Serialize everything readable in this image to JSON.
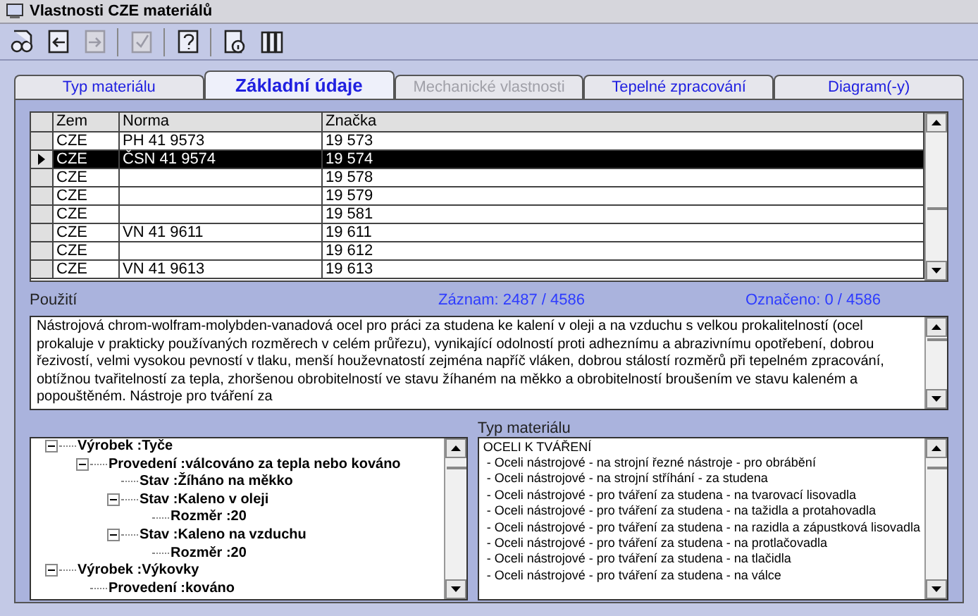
{
  "window": {
    "title": "Vlastnosti CZE materiálů"
  },
  "toolbar": [
    {
      "kind": "people",
      "disabled": false
    },
    {
      "kind": "back",
      "disabled": false
    },
    {
      "kind": "forward",
      "disabled": true
    },
    {
      "kind": "check",
      "disabled": true
    },
    {
      "kind": "help",
      "disabled": false
    },
    {
      "kind": "info",
      "disabled": false
    },
    {
      "kind": "columns",
      "disabled": false
    }
  ],
  "tabs": [
    {
      "label": "Typ materiálu",
      "selected": false,
      "disabled": false
    },
    {
      "label": "Základní údaje",
      "selected": true,
      "disabled": false
    },
    {
      "label": "Mechanické vlastnosti",
      "selected": false,
      "disabled": true
    },
    {
      "label": "Tepelné zpracování",
      "selected": false,
      "disabled": false
    },
    {
      "label": "Diagram(-y)",
      "selected": false,
      "disabled": false
    }
  ],
  "table": {
    "columns": [
      "Zem",
      "Norma",
      "Značka"
    ],
    "rows": [
      {
        "cells": [
          "CZE",
          "PH 41 9573",
          "19 573"
        ],
        "selected": false
      },
      {
        "cells": [
          "CZE",
          "ČSN 41 9574",
          "19 574"
        ],
        "selected": true
      },
      {
        "cells": [
          "CZE",
          "",
          "19 578"
        ],
        "selected": false
      },
      {
        "cells": [
          "CZE",
          "",
          "19 579"
        ],
        "selected": false
      },
      {
        "cells": [
          "CZE",
          "",
          "19 581"
        ],
        "selected": false
      },
      {
        "cells": [
          "CZE",
          "VN 41 9611",
          "19 611"
        ],
        "selected": false
      },
      {
        "cells": [
          "CZE",
          "",
          "19 612"
        ],
        "selected": false
      },
      {
        "cells": [
          "CZE",
          "VN 41 9613",
          "19 613"
        ],
        "selected": false
      }
    ]
  },
  "status": {
    "usage_label": "Použití",
    "record": "Záznam: 2487 / 4586",
    "marked": "Označeno: 0 / 4586"
  },
  "description": "Nástrojová chrom-wolfram-molybden-vanadová ocel pro práci za studena ke kalení v oleji a na vzduchu s velkou prokalitelností (ocel prokaluje v prakticky používaných rozměrech v celém průřezu), vynikající odolností proti adheznímu a abrazivnímu opotřebení, dobrou řezivostí, velmi vysokou pevností v tlaku, menší houževnatostí zejména napříč vláken, dobrou stálostí rozměrů při tepelném zpracování, obtížnou tvařitelností za tepla, zhoršenou obrobitelností ve stavu žíhaném na měkko a obrobitelností broušením ve stavu kaleném a popouštěném. Nástroje pro tváření za",
  "tree": [
    {
      "label": "Výrobek :Tyče",
      "expanded": true,
      "children": [
        {
          "label": "Provedení :válcováno za tepla nebo kováno",
          "expanded": true,
          "children": [
            {
              "label": "Stav :Žíháno na měkko"
            },
            {
              "label": "Stav :Kaleno v oleji",
              "expanded": true,
              "children": [
                {
                  "label": "Rozměr :20"
                }
              ]
            },
            {
              "label": "Stav :Kaleno na vzduchu",
              "expanded": true,
              "children": [
                {
                  "label": "Rozměr :20"
                }
              ]
            }
          ]
        }
      ]
    },
    {
      "label": "Výrobek :Výkovky",
      "expanded": true,
      "children": [
        {
          "label": "Provedení :kováno"
        }
      ]
    }
  ],
  "material_type": {
    "label": "Typ materiálu",
    "items": [
      "OCELI K TVÁŘENÍ",
      " - Oceli nástrojové - na strojní řezné nástroje - pro obrábění",
      " - Oceli nástrojové - na strojní stříhání - za studena",
      " - Oceli nástrojové - pro tváření za studena - na tvarovací lisovadla",
      " - Oceli nástrojové - pro tváření za studena - na tažidla a protahovadla",
      " - Oceli nástrojové - pro tváření za studena - na razidla a zápustková lisovadla",
      " - Oceli nástrojové - pro tváření za studena - na protlačovadla",
      " - Oceli nástrojové - pro tváření za studena - na tlačidla",
      " - Oceli nástrojové - pro tváření za studena - na válce"
    ]
  }
}
